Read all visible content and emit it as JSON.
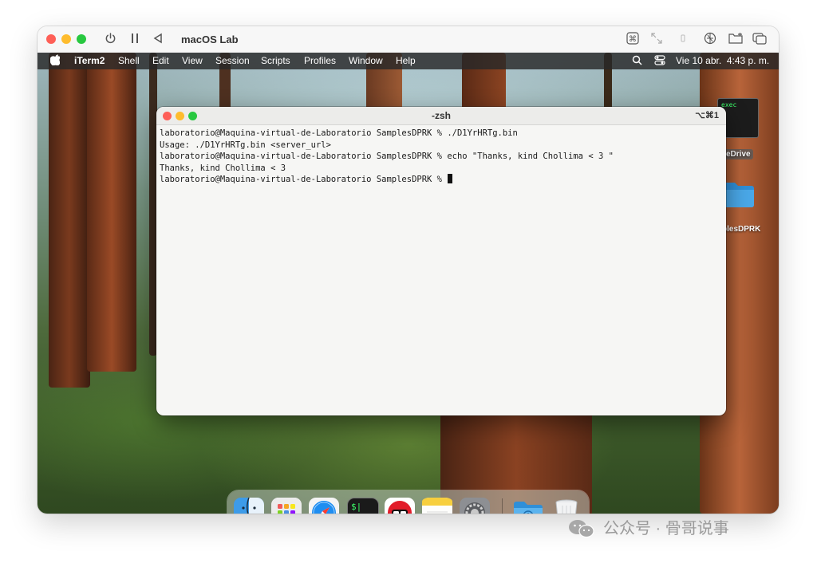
{
  "vm": {
    "title": "macOS Lab",
    "controls": [
      "power-icon",
      "pause-icon",
      "back-icon"
    ],
    "tools": [
      "command-key-icon",
      "resize-icon",
      "usb-icon",
      "network-icon",
      "shared-folder-icon",
      "windows-icon"
    ]
  },
  "menubar": {
    "apple_icon": "apple-icon",
    "app_name": "iTerm2",
    "items": [
      "Shell",
      "Edit",
      "View",
      "Session",
      "Scripts",
      "Profiles",
      "Window",
      "Help"
    ],
    "datetime": "Vie 10 abr.  4:43 p. m.",
    "right_icons": [
      "search-icon",
      "control-center-icon"
    ]
  },
  "desktop": {
    "exec_icon_text": "exec",
    "onedrive_label": "eDrive",
    "folder_label": "plesDPRK"
  },
  "terminal": {
    "title": "-zsh",
    "shortcut": "⌥⌘1",
    "lines": [
      "laboratorio@Maquina-virtual-de-Laboratorio SamplesDPRK % ./D1YrHRTg.bin",
      "Usage: ./D1YrHRTg.bin <server_url>",
      "laboratorio@Maquina-virtual-de-Laboratorio SamplesDPRK % echo \"Thanks, kind Chollima < 3 \"",
      "Thanks, kind Chollima < 3",
      "laboratorio@Maquina-virtual-de-Laboratorio SamplesDPRK % "
    ]
  },
  "dock": {
    "apps": [
      "finder-icon",
      "launchpad-icon",
      "safari-icon",
      "terminal-icon",
      "objective-see-icon",
      "notes-icon",
      "system-settings-icon"
    ],
    "others": [
      "downloads-folder-icon",
      "trash-icon"
    ],
    "terminal_glyph": "$|"
  },
  "watermark": {
    "text": "公众号 · 骨哥说事"
  },
  "colors": {
    "close": "#fe5f57",
    "minimize": "#febc2e",
    "zoom": "#28c840",
    "folder_blue": "#4aa8e8"
  }
}
